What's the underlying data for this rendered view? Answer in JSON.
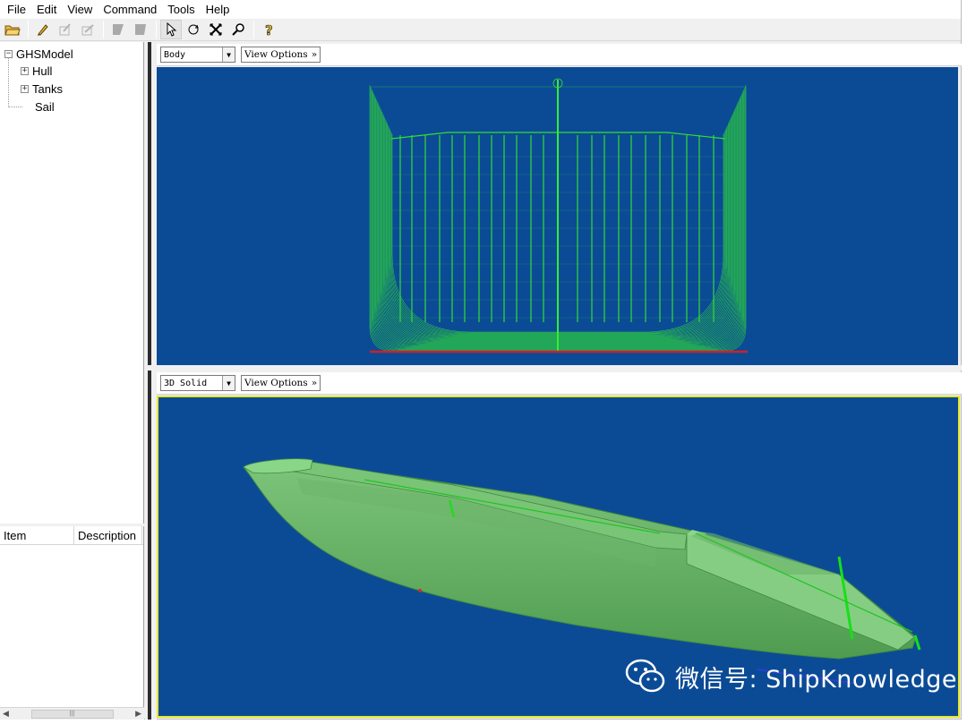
{
  "menu": [
    "File",
    "Edit",
    "View",
    "Command",
    "Tools",
    "Help"
  ],
  "toolbar": {
    "groups": [
      [
        {
          "icon": "open-folder-icon",
          "glyph": "📂",
          "enabled": true
        }
      ],
      [
        {
          "icon": "pencil-icon",
          "glyph": "✎",
          "enabled": true
        },
        {
          "icon": "edit-shape-icon",
          "glyph": "✐",
          "enabled": false
        },
        {
          "icon": "edit-shape-alt-icon",
          "glyph": "✑",
          "enabled": false
        }
      ],
      [
        {
          "icon": "panel-icon",
          "glyph": "◤",
          "enabled": false
        },
        {
          "icon": "panel-alt-icon",
          "glyph": "◣",
          "enabled": false
        }
      ],
      [
        {
          "icon": "pointer-icon",
          "glyph": "↖",
          "enabled": true,
          "active": true
        },
        {
          "icon": "rotate-icon",
          "glyph": "⟲",
          "enabled": true
        },
        {
          "icon": "pan-icon",
          "glyph": "✖",
          "enabled": true
        },
        {
          "icon": "zoom-icon",
          "glyph": "⌕",
          "enabled": true
        }
      ],
      [
        {
          "icon": "help-icon",
          "glyph": "?",
          "enabled": true
        }
      ]
    ]
  },
  "tree": {
    "root": "GHSModel",
    "children": [
      {
        "label": "Hull",
        "expandable": true
      },
      {
        "label": "Tanks",
        "expandable": true
      },
      {
        "label": "Sail",
        "expandable": false
      }
    ]
  },
  "list": {
    "columns": [
      "Item",
      "Description"
    ]
  },
  "top_view": {
    "view_select": "Body",
    "options_label": "View Options",
    "options_glyph": "»"
  },
  "bottom_view": {
    "view_select": "3D Solid",
    "options_label": "View Options",
    "options_glyph": "»"
  },
  "colors": {
    "canvas": "#0b4b96",
    "wireframe": "#33dd33",
    "hull_solid": "#6cb86a",
    "baseline": "#d0202a",
    "active_border": "#e6e62a"
  },
  "watermark": "微信号: ShipKnowledge"
}
